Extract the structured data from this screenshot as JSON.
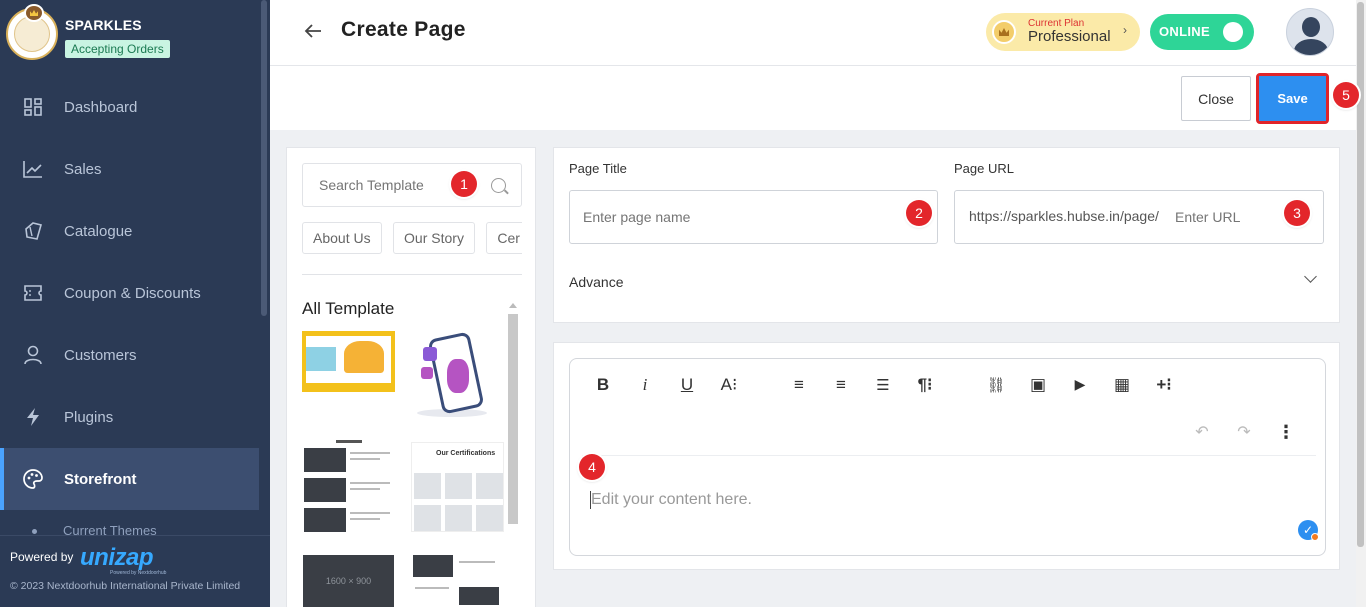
{
  "sidebar": {
    "brand_name": "SPARKLES",
    "status_badge": "Accepting Orders",
    "items": [
      {
        "label": "Dashboard",
        "icon": "dashboard-icon"
      },
      {
        "label": "Sales",
        "icon": "chart-line-icon"
      },
      {
        "label": "Catalogue",
        "icon": "tag-icon"
      },
      {
        "label": "Coupon & Discounts",
        "icon": "ticket-icon"
      },
      {
        "label": "Customers",
        "icon": "user-icon"
      },
      {
        "label": "Plugins",
        "icon": "lightning-icon"
      },
      {
        "label": "Storefront",
        "icon": "palette-icon",
        "active": true
      }
    ],
    "sub_item": "Current Themes",
    "footer": {
      "powered_by": "Powered by",
      "brand": "unizap",
      "brand_sub": "Powered by Nextdoorhub",
      "copyright": "© 2023 Nextdoorhub International Private Limited"
    }
  },
  "header": {
    "back_icon": "arrow-left-icon",
    "title": "Create Page",
    "plan_caption": "Current Plan",
    "plan_name": "Professional",
    "status_toggle": "ONLINE"
  },
  "actions": {
    "close_label": "Close",
    "save_label": "Save"
  },
  "templates": {
    "search_placeholder": "Search Template",
    "chips": [
      "About Us",
      "Our Story",
      "Cer"
    ],
    "all_title": "All Template",
    "thumb_certifications": "Our Certifications",
    "thumb_placeholder": "1600 × 900"
  },
  "form": {
    "page_title_label": "Page Title",
    "page_title_placeholder": "Enter page name",
    "page_url_label": "Page URL",
    "url_prefix": "https://sparkles.hubse.in/page/",
    "url_placeholder": "Enter URL",
    "advance_label": "Advance"
  },
  "editor": {
    "toolbar": [
      {
        "name": "bold-icon",
        "glyph": "B"
      },
      {
        "name": "italic-icon",
        "glyph": "i"
      },
      {
        "name": "underline-icon",
        "glyph": "U"
      },
      {
        "name": "font-size-icon",
        "glyph": "A⁝"
      },
      {
        "name": "align-left-icon",
        "glyph": "≡"
      },
      {
        "name": "align-center-icon",
        "glyph": "≡"
      },
      {
        "name": "ordered-list-icon",
        "glyph": "☰"
      },
      {
        "name": "paragraph-icon",
        "glyph": "¶⁝"
      },
      {
        "name": "link-icon",
        "glyph": "⛓"
      },
      {
        "name": "image-icon",
        "glyph": "▣"
      },
      {
        "name": "video-icon",
        "glyph": "▶"
      },
      {
        "name": "table-icon",
        "glyph": "▦"
      },
      {
        "name": "insert-more-icon",
        "glyph": "+⁝"
      }
    ],
    "content_placeholder": "Edit your content here."
  },
  "steps": [
    "1",
    "2",
    "3",
    "4",
    "5"
  ],
  "colors": {
    "sidebar_bg": "#2b3a55",
    "accent": "#2d8ff0",
    "online": "#2ed597",
    "step_marker": "#e3262b"
  }
}
